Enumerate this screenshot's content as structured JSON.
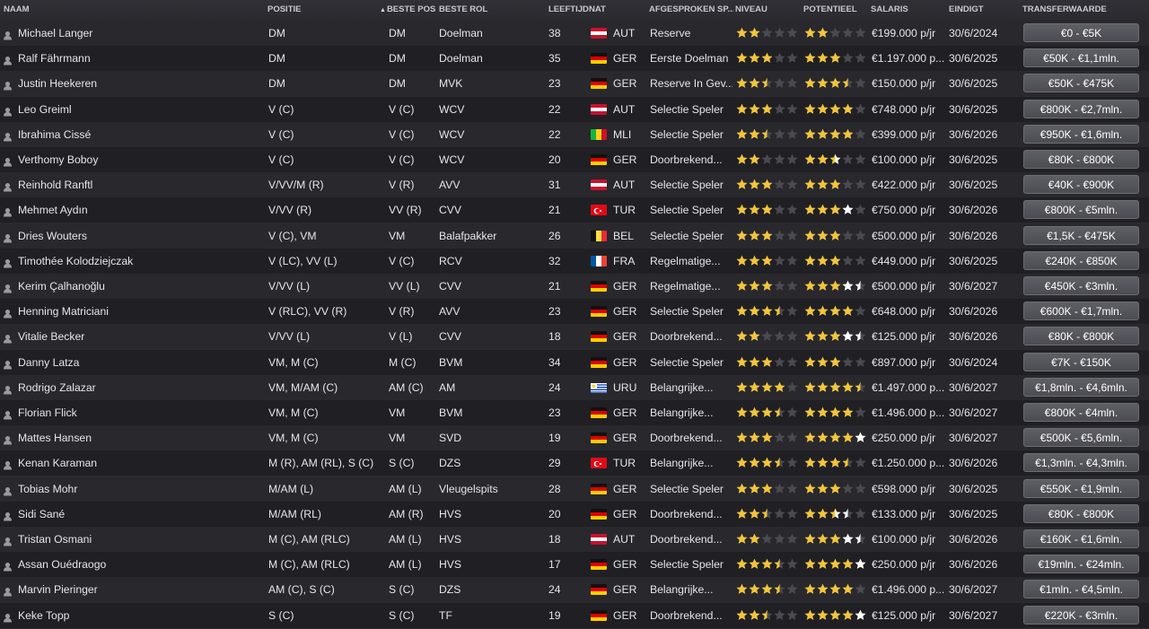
{
  "columns": {
    "naam": "NAAM",
    "positie": "POSITIE",
    "beste_pos": "BESTE POS",
    "beste_rol": "BESTE ROL",
    "leeftijd": "LEEFTIJD",
    "nat": "NAT",
    "afgesproken": "AFGESPROKEN SP...",
    "niveau": "NIVEAU",
    "potentieel": "POTENTIEEL",
    "salaris": "SALARIS",
    "eindigt": "EINDIGT",
    "transferwaarde": "TRANSFERWAARDE"
  },
  "sort_indicator": "▲",
  "colors": {
    "star_gold": "#f2c53d",
    "star_empty": "#4a4a50",
    "star_white": "#ffffff"
  },
  "players": [
    {
      "name": "Michael Langer",
      "positie": "DM",
      "beste_pos": "DM",
      "rol": "Doelman",
      "age": "38",
      "nat": "AUT",
      "status": "Reserve",
      "niveau": 2,
      "pot": 2,
      "salary": "€199.000 p/jr",
      "end": "30/6/2024",
      "value": "€0 - €5K"
    },
    {
      "name": "Ralf Fährmann",
      "positie": "DM",
      "beste_pos": "DM",
      "rol": "Doelman",
      "age": "35",
      "nat": "GER",
      "status": "Eerste Doelman",
      "niveau": 3,
      "pot": 3,
      "salary": "€1.197.000 p...",
      "end": "30/6/2025",
      "value": "€50K - €1,1mln."
    },
    {
      "name": "Justin Heekeren",
      "positie": "DM",
      "beste_pos": "DM",
      "rol": "MVK",
      "age": "23",
      "nat": "GER",
      "status": "Reserve In Gev...",
      "niveau": 2.5,
      "pot": 3.5,
      "salary": "€150.000 p/jr",
      "end": "30/6/2025",
      "value": "€50K - €475K"
    },
    {
      "name": "Leo Greiml",
      "positie": "V (C)",
      "beste_pos": "V (C)",
      "rol": "WCV",
      "age": "22",
      "nat": "AUT",
      "status": "Selectie Speler",
      "niveau": 3,
      "pot": 4,
      "salary": "€748.000 p/jr",
      "end": "30/6/2025",
      "value": "€800K - €2,7mln."
    },
    {
      "name": "Ibrahima Cissé",
      "positie": "V (C)",
      "beste_pos": "V (C)",
      "rol": "WCV",
      "age": "22",
      "nat": "MLI",
      "status": "Selectie Speler",
      "niveau": 2.5,
      "pot": 4,
      "salary": "€399.000 p/jr",
      "end": "30/6/2026",
      "value": "€950K - €1,6mln."
    },
    {
      "name": "Verthomy Boboy",
      "positie": "V (C)",
      "beste_pos": "V (C)",
      "rol": "WCV",
      "age": "20",
      "nat": "GER",
      "status": "Doorbrekend...",
      "niveau": 2,
      "pot": 2.5,
      "pot_white": 0.5,
      "salary": "€100.000 p/jr",
      "end": "30/6/2025",
      "value": "€80K - €800K"
    },
    {
      "name": "Reinhold Ranftl",
      "positie": "V/VV/M (R)",
      "beste_pos": "V (R)",
      "rol": "AVV",
      "age": "31",
      "nat": "AUT",
      "status": "Selectie Speler",
      "niveau": 3,
      "pot": 3,
      "salary": "€422.000 p/jr",
      "end": "30/6/2025",
      "value": "€40K - €900K"
    },
    {
      "name": "Mehmet Aydın",
      "positie": "V/VV (R)",
      "beste_pos": "VV (R)",
      "rol": "CVV",
      "age": "21",
      "nat": "TUR",
      "status": "Selectie Speler",
      "niveau": 3,
      "pot": 3,
      "pot_white": 1,
      "salary": "€750.000 p/jr",
      "end": "30/6/2026",
      "value": "€800K - €5mln."
    },
    {
      "name": "Dries Wouters",
      "positie": "V (C), VM",
      "beste_pos": "VM",
      "rol": "Balafpakker",
      "age": "26",
      "nat": "BEL",
      "status": "Selectie Speler",
      "niveau": 3,
      "pot": 3,
      "salary": "€500.000 p/jr",
      "end": "30/6/2026",
      "value": "€1,5K - €475K"
    },
    {
      "name": "Timothée Kolodziejczak",
      "positie": "V (LC), VV (L)",
      "beste_pos": "V (C)",
      "rol": "RCV",
      "age": "32",
      "nat": "FRA",
      "status": "Regelmatige...",
      "niveau": 3,
      "pot": 3,
      "salary": "€449.000 p/jr",
      "end": "30/6/2025",
      "value": "€240K - €850K"
    },
    {
      "name": "Kerim Çalhanoğlu",
      "positie": "V/VV (L)",
      "beste_pos": "VV (L)",
      "rol": "CVV",
      "age": "21",
      "nat": "GER",
      "status": "Regelmatige...",
      "niveau": 3,
      "pot": 3,
      "pot_white": 1.5,
      "salary": "€500.000 p/jr",
      "end": "30/6/2027",
      "value": "€450K - €3mln."
    },
    {
      "name": "Henning Matriciani",
      "positie": "V (RLC), VV (R)",
      "beste_pos": "V (R)",
      "rol": "AVV",
      "age": "23",
      "nat": "GER",
      "status": "Selectie Speler",
      "niveau": 3.5,
      "pot": 4,
      "salary": "€648.000 p/jr",
      "end": "30/6/2026",
      "value": "€600K - €1,7mln."
    },
    {
      "name": "Vitalie Becker",
      "positie": "V/VV (L)",
      "beste_pos": "V (L)",
      "rol": "CVV",
      "age": "18",
      "nat": "GER",
      "status": "Doorbrekend...",
      "niveau": 2,
      "pot": 3,
      "pot_white": 1.5,
      "salary": "€125.000 p/jr",
      "end": "30/6/2026",
      "value": "€80K - €800K"
    },
    {
      "name": "Danny Latza",
      "positie": "VM, M (C)",
      "beste_pos": "M (C)",
      "rol": "BVM",
      "age": "34",
      "nat": "GER",
      "status": "Selectie Speler",
      "niveau": 3,
      "pot": 3,
      "salary": "€897.000 p/jr",
      "end": "30/6/2024",
      "value": "€7K - €150K"
    },
    {
      "name": "Rodrigo Zalazar",
      "positie": "VM, M/AM (C)",
      "beste_pos": "AM (C)",
      "rol": "AM",
      "age": "24",
      "nat": "URU",
      "status": "Belangrijke...",
      "niveau": 4,
      "pot": 4.5,
      "salary": "€1.497.000 p...",
      "end": "30/6/2027",
      "value": "€1,8mln. - €4,6mln."
    },
    {
      "name": "Florian Flick",
      "positie": "VM, M (C)",
      "beste_pos": "VM",
      "rol": "BVM",
      "age": "23",
      "nat": "GER",
      "status": "Belangrijke...",
      "niveau": 3.5,
      "pot": 4,
      "salary": "€1.496.000 p...",
      "end": "30/6/2027",
      "value": "€800K - €4mln."
    },
    {
      "name": "Mattes Hansen",
      "positie": "VM, M (C)",
      "beste_pos": "VM",
      "rol": "SVD",
      "age": "19",
      "nat": "GER",
      "status": "Doorbrekend...",
      "niveau": 3,
      "pot": 4,
      "pot_white": 1,
      "salary": "€250.000 p/jr",
      "end": "30/6/2027",
      "value": "€500K - €5,6mln."
    },
    {
      "name": "Kenan Karaman",
      "positie": "M (R), AM (RL), S (C)",
      "beste_pos": "S (C)",
      "rol": "DZS",
      "age": "29",
      "nat": "TUR",
      "status": "Belangrijke...",
      "niveau": 3.5,
      "pot": 3.5,
      "salary": "€1.250.000 p...",
      "end": "30/6/2026",
      "value": "€1,3mln. - €4,3mln."
    },
    {
      "name": "Tobias Mohr",
      "positie": "M/AM (L)",
      "beste_pos": "AM (L)",
      "rol": "Vleugelspits",
      "age": "28",
      "nat": "GER",
      "status": "Selectie Speler",
      "niveau": 3,
      "pot": 3,
      "salary": "€598.000 p/jr",
      "end": "30/6/2025",
      "value": "€550K - €1,9mln."
    },
    {
      "name": "Sidi Sané",
      "positie": "M/AM (RL)",
      "beste_pos": "AM (R)",
      "rol": "HVS",
      "age": "20",
      "nat": "GER",
      "status": "Doorbrekend...",
      "niveau": 2.5,
      "pot": 2.5,
      "pot_white": 1,
      "salary": "€133.000 p/jr",
      "end": "30/6/2025",
      "value": "€80K - €800K"
    },
    {
      "name": "Tristan Osmani",
      "positie": "M (C), AM (RLC)",
      "beste_pos": "AM (L)",
      "rol": "HVS",
      "age": "18",
      "nat": "AUT",
      "status": "Doorbrekend...",
      "niveau": 2,
      "pot": 3,
      "pot_white": 1.5,
      "salary": "€100.000 p/jr",
      "end": "30/6/2026",
      "value": "€160K - €1,6mln."
    },
    {
      "name": "Assan Ouédraogo",
      "positie": "M (C), AM (RLC)",
      "beste_pos": "AM (L)",
      "rol": "HVS",
      "age": "17",
      "nat": "GER",
      "status": "Selectie Speler",
      "niveau": 3.5,
      "pot": 4,
      "pot_white": 1,
      "salary": "€250.000 p/jr",
      "end": "30/6/2026",
      "value": "€19mln. - €24mln."
    },
    {
      "name": "Marvin Pieringer",
      "positie": "AM (C), S (C)",
      "beste_pos": "S (C)",
      "rol": "DZS",
      "age": "24",
      "nat": "GER",
      "status": "Belangrijke...",
      "niveau": 3.5,
      "pot": 4,
      "salary": "€1.496.000 p...",
      "end": "30/6/2027",
      "value": "€1mln. - €4,5mln."
    },
    {
      "name": "Keke Topp",
      "positie": "S (C)",
      "beste_pos": "S (C)",
      "rol": "TF",
      "age": "19",
      "nat": "GER",
      "status": "Doorbrekend...",
      "niveau": 2.5,
      "pot": 4,
      "pot_white": 1,
      "salary": "€125.000 p/jr",
      "end": "30/6/2027",
      "value": "€220K - €3mln."
    }
  ]
}
